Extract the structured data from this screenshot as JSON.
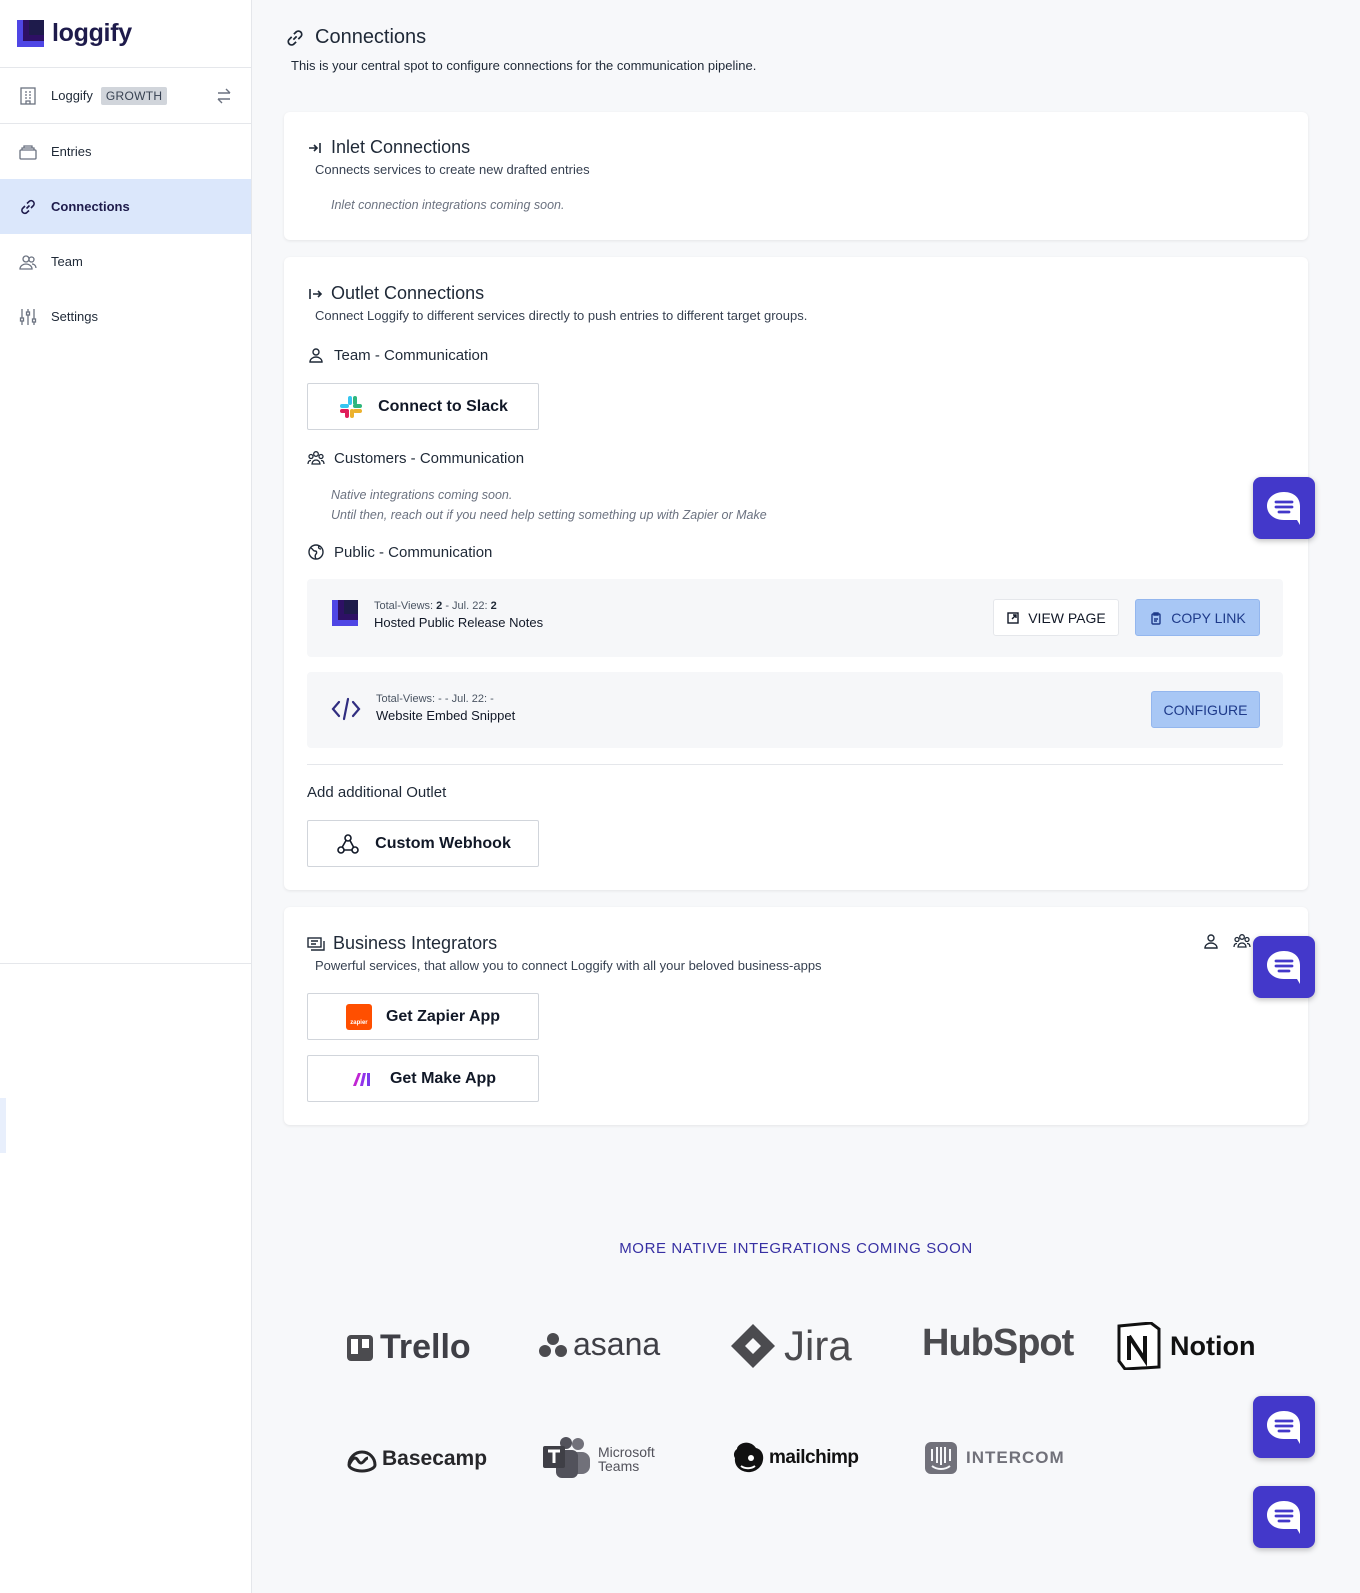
{
  "app": {
    "name": "loggify"
  },
  "sidebar": {
    "org_name": "Loggify",
    "plan_badge": "GROWTH",
    "items": [
      {
        "label": "Entries"
      },
      {
        "label": "Connections"
      },
      {
        "label": "Team"
      },
      {
        "label": "Settings"
      }
    ]
  },
  "page": {
    "title": "Connections",
    "subtitle": "This is your central spot to configure connections for the communication pipeline."
  },
  "inlet": {
    "title": "Inlet Connections",
    "subtitle": "Connects services to create new drafted entries",
    "note": "Inlet connection integrations coming soon."
  },
  "outlet": {
    "title": "Outlet Connections",
    "subtitle": "Connect Loggify to different services directly to push entries to different target groups.",
    "team_title": "Team - Communication",
    "slack_button": "Connect to Slack",
    "customers_title": "Customers - Communication",
    "customers_note_1": "Native integrations coming soon.",
    "customers_note_2": "Until then, reach out if you need help setting something up with Zapier or Make",
    "public_title": "Public - Communication",
    "rows": [
      {
        "meta_prefix": "Total-Views: ",
        "views": "2",
        "meta_mid": " - Jul. 22: ",
        "day_views": "2",
        "name": "Hosted Public Release Notes",
        "btn_view": "VIEW PAGE",
        "btn_copy": "COPY LINK"
      },
      {
        "meta": "Total-Views: - - Jul. 22: -",
        "name": "Website Embed Snippet",
        "btn_configure": "CONFIGURE"
      }
    ],
    "additional_title": "Add additional Outlet",
    "webhook_button": "Custom Webhook"
  },
  "business": {
    "title": "Business Integrators",
    "subtitle": "Powerful services, that allow you to connect Loggify with all your beloved business-apps",
    "zapier_button": "Get Zapier App",
    "zapier_icon_text": "zapier",
    "make_button": "Get Make App"
  },
  "coming_soon": {
    "title": "MORE NATIVE INTEGRATIONS COMING SOON",
    "brands": [
      "Trello",
      "asana",
      "Jira",
      "HubSpot",
      "Notion",
      "Basecamp",
      "Microsoft",
      "Teams",
      "mailchimp",
      "INTERCOM"
    ]
  },
  "colors": {
    "accent": "#4338ca",
    "active_nav": "#dbe7fb",
    "button_blue": "#a8c7f5"
  },
  "icons": [
    "building-icon",
    "swap-icon",
    "entries-icon",
    "link-icon",
    "team-icon",
    "settings-icon",
    "inlet-icon",
    "outlet-icon",
    "customers-icon",
    "globe-icon",
    "slack-icon",
    "code-icon",
    "webhook-icon",
    "business-icon",
    "zapier-icon",
    "make-icon",
    "chat-icon"
  ]
}
